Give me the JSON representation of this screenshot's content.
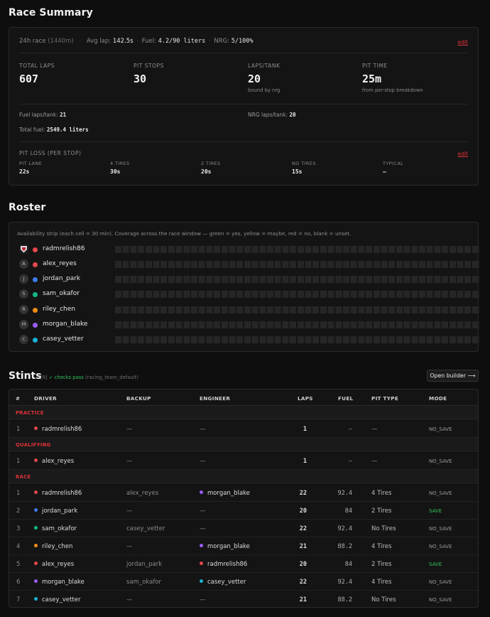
{
  "summary": {
    "title": "Race Summary",
    "race": "24h race",
    "race_minutes": "(1440m)",
    "avg_lap_label": "Avg lap:",
    "avg_lap": "142.5s",
    "fuel_label": "Fuel:",
    "fuel": "4.2/90 liters",
    "nrg_label": "NRG:",
    "nrg": "5/100%",
    "edit_label": "edit",
    "stats": [
      {
        "label": "TOTAL LAPS",
        "value": "607",
        "sub": ""
      },
      {
        "label": "PIT STOPS",
        "value": "30",
        "sub": ""
      },
      {
        "label": "LAPS/TANK",
        "value": "20",
        "sub": "bound by nrg"
      },
      {
        "label": "PIT TIME",
        "value": "25m",
        "sub": "from per-stop breakdown"
      }
    ],
    "fuel_laps_label": "Fuel laps/tank:",
    "fuel_laps": "21",
    "nrg_laps_label": "NRG laps/tank:",
    "nrg_laps": "20",
    "total_fuel_label": "Total fuel:",
    "total_fuel": "2549.4 liters",
    "pit_loss_title": "PIT LOSS (PER STOP)",
    "pit_loss": [
      {
        "label": "PIT LANE",
        "value": "22s"
      },
      {
        "label": "4 TIRES",
        "value": "30s"
      },
      {
        "label": "2 TIRES",
        "value": "20s"
      },
      {
        "label": "NO TIRES",
        "value": "15s"
      },
      {
        "label": "TYPICAL",
        "value": "—"
      }
    ]
  },
  "roster": {
    "title": "Roster",
    "note": "Availability strip (each cell = 30 min). Coverage across the race window — green = yes, yellow = maybe, red = no, blank = unset.",
    "members": [
      {
        "initial": "",
        "name": "radmrelish86",
        "color": "#e5484d",
        "logo": true
      },
      {
        "initial": "A",
        "name": "alex_reyes",
        "color": "#e5484d"
      },
      {
        "initial": "J",
        "name": "jordan_park",
        "color": "#3e7bf0"
      },
      {
        "initial": "S",
        "name": "sam_okafor",
        "color": "#12b886"
      },
      {
        "initial": "R",
        "name": "riley_chen",
        "color": "#f08c1a"
      },
      {
        "initial": "M",
        "name": "morgan_blake",
        "color": "#9b5cf6"
      },
      {
        "initial": "C",
        "name": "casey_vetter",
        "color": "#18b3d6"
      }
    ]
  },
  "stints": {
    "title": "Stints",
    "count": "[9]",
    "check": "✓ checks pass",
    "profile": "(racing_team_default)",
    "builder_label": "Open builder ⟶",
    "headers": {
      "num": "#",
      "driver": "DRIVER",
      "backup": "BACKUP",
      "engineer": "ENGINEER",
      "laps": "LAPS",
      "fuel": "FUEL",
      "pit": "PIT TYPE",
      "mode": "MODE"
    },
    "groups": [
      {
        "name": "PRACTICE",
        "rows": [
          {
            "num": "1",
            "driver": "radmrelish86",
            "driver_color": "#e5484d",
            "backup": "—",
            "engineer": "—",
            "engineer_color": "",
            "laps": "1",
            "fuel": "—",
            "pit": "—",
            "mode": "NO_SAVE"
          }
        ]
      },
      {
        "name": "QUALIFYING",
        "rows": [
          {
            "num": "1",
            "driver": "alex_reyes",
            "driver_color": "#e5484d",
            "backup": "—",
            "engineer": "—",
            "engineer_color": "",
            "laps": "1",
            "fuel": "—",
            "pit": "—",
            "mode": "NO_SAVE"
          }
        ]
      },
      {
        "name": "RACE",
        "rows": [
          {
            "num": "1",
            "driver": "radmrelish86",
            "driver_color": "#e5484d",
            "backup": "alex_reyes",
            "engineer": "morgan_blake",
            "engineer_color": "#9b5cf6",
            "laps": "22",
            "fuel": "92.4",
            "pit": "4 Tires",
            "mode": "NO_SAVE"
          },
          {
            "num": "2",
            "driver": "jordan_park",
            "driver_color": "#3e7bf0",
            "backup": "—",
            "engineer": "—",
            "engineer_color": "",
            "laps": "20",
            "fuel": "84",
            "pit": "2 Tires",
            "mode": "SAVE"
          },
          {
            "num": "3",
            "driver": "sam_okafor",
            "driver_color": "#12b886",
            "backup": "casey_vetter",
            "engineer": "—",
            "engineer_color": "",
            "laps": "22",
            "fuel": "92.4",
            "pit": "No Tires",
            "mode": "NO_SAVE"
          },
          {
            "num": "4",
            "driver": "riley_chen",
            "driver_color": "#f08c1a",
            "backup": "—",
            "engineer": "morgan_blake",
            "engineer_color": "#9b5cf6",
            "laps": "21",
            "fuel": "88.2",
            "pit": "4 Tires",
            "mode": "NO_SAVE"
          },
          {
            "num": "5",
            "driver": "alex_reyes",
            "driver_color": "#e5484d",
            "backup": "jordan_park",
            "engineer": "radmrelish86",
            "engineer_color": "#e5484d",
            "laps": "20",
            "fuel": "84",
            "pit": "2 Tires",
            "mode": "SAVE"
          },
          {
            "num": "6",
            "driver": "morgan_blake",
            "driver_color": "#9b5cf6",
            "backup": "sam_okafor",
            "engineer": "casey_vetter",
            "engineer_color": "#18b3d6",
            "laps": "22",
            "fuel": "92.4",
            "pit": "4 Tires",
            "mode": "NO_SAVE"
          },
          {
            "num": "7",
            "driver": "casey_vetter",
            "driver_color": "#18b3d6",
            "backup": "—",
            "engineer": "—",
            "engineer_color": "",
            "laps": "21",
            "fuel": "88.2",
            "pit": "No Tires",
            "mode": "NO_SAVE"
          }
        ]
      }
    ]
  }
}
